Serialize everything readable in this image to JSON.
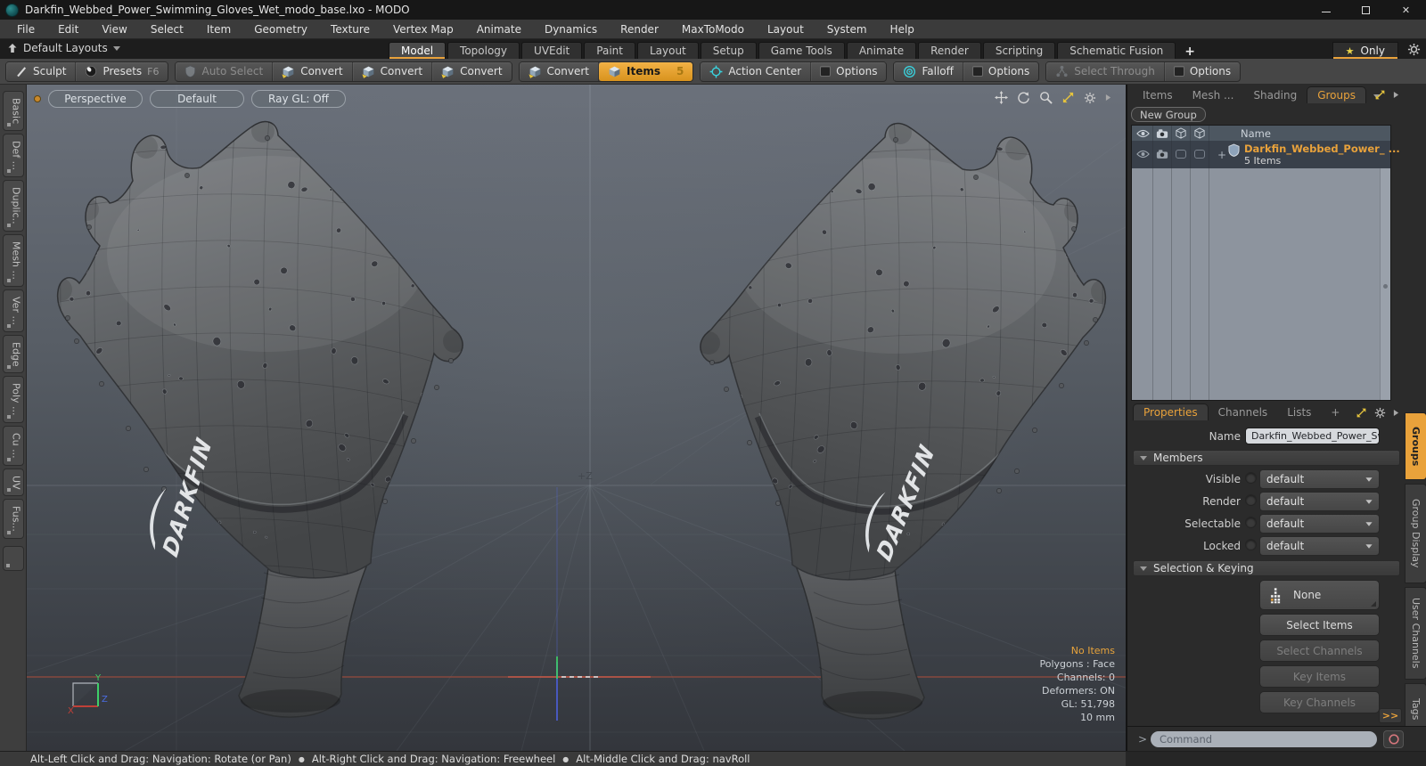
{
  "window": {
    "title": "Darkfin_Webbed_Power_Swimming_Gloves_Wet_modo_base.lxo - MODO",
    "close": "✕"
  },
  "menu": {
    "items": [
      "File",
      "Edit",
      "View",
      "Select",
      "Item",
      "Geometry",
      "Texture",
      "Vertex Map",
      "Animate",
      "Dynamics",
      "Render",
      "MaxToModo",
      "Layout",
      "System",
      "Help"
    ]
  },
  "layout_bar": {
    "switcher": "Default Layouts",
    "tabs": [
      "Model",
      "Topology",
      "UVEdit",
      "Paint",
      "Layout",
      "Setup",
      "Game Tools",
      "Animate",
      "Render",
      "Scripting",
      "Schematic Fusion"
    ],
    "add_tab": "+",
    "only": "Only"
  },
  "toolbar": {
    "sculpt": "Sculpt",
    "presets": "Presets",
    "presets_key": "F6",
    "auto_select": "Auto Select",
    "convert": "Convert",
    "items": "Items",
    "items_count": "5",
    "action_center": "Action Center",
    "options": "Options",
    "falloff": "Falloff",
    "select_through": "Select Through"
  },
  "left_tabs": {
    "items": [
      "Basic",
      "Def ...",
      "Duplic..",
      "Mesh ...",
      "Ver ...",
      "Edge",
      "Poly ...",
      "Cu ...",
      "UV",
      "Fus..."
    ]
  },
  "viewport": {
    "camera": "Perspective",
    "shading": "Default",
    "raygl": "Ray GL: Off",
    "axis_hint": "+Z",
    "gizmo": {
      "x": "X",
      "y": "Y",
      "z": "Z"
    },
    "info": {
      "selection": "No Items",
      "mode": "Polygons : Face",
      "channels": "Channels: 0",
      "deformers": "Deformers: ON",
      "gl": "GL: 51,798",
      "grid": "10 mm"
    },
    "glove_logo": "DARKFIN"
  },
  "items_panel": {
    "tabs": [
      "Items",
      "Mesh ...",
      "Shading",
      "Groups"
    ],
    "new_group": "New Group",
    "header_name": "Name",
    "expand": "+",
    "group_name": "Darkfin_Webbed_Power_ ...",
    "group_sub": "5 Items"
  },
  "properties": {
    "tabs": [
      "Properties",
      "Channels",
      "Lists"
    ],
    "add_tab": "+",
    "name_label": "Name",
    "name_value": "Darkfin_Webbed_Power_Swimmir",
    "members_title": "Members",
    "rows": [
      {
        "label": "Visible",
        "value": "default"
      },
      {
        "label": "Render",
        "value": "default"
      },
      {
        "label": "Selectable",
        "value": "default"
      },
      {
        "label": "Locked",
        "value": "default"
      }
    ],
    "selection_title": "Selection & Keying",
    "none_button": "None",
    "select_items": "Select Items",
    "select_channels": "Select Channels",
    "key_items": "Key Items",
    "key_channels": "Key Channels",
    "more": ">>"
  },
  "side_tabs": {
    "items": [
      "Groups",
      "Group Display",
      "User Channels",
      "Tags"
    ]
  },
  "command": {
    "prompt": ">",
    "placeholder": "Command"
  },
  "status_bar": {
    "separator": "●",
    "hints": [
      "Alt-Left Click and Drag: Navigation: Rotate (or Pan)",
      "Alt-Right Click and Drag: Navigation: Freewheel",
      "Alt-Middle Click and Drag: navRoll"
    ]
  },
  "colors": {
    "accent_orange": "#e9a23b",
    "tool_cyan": "#3ad2de",
    "star_yellow": "#e8d44a",
    "axis_red": "#8f4a3e",
    "axis_green": "#3ecf68",
    "axis_blue": "#4a5ccc"
  }
}
